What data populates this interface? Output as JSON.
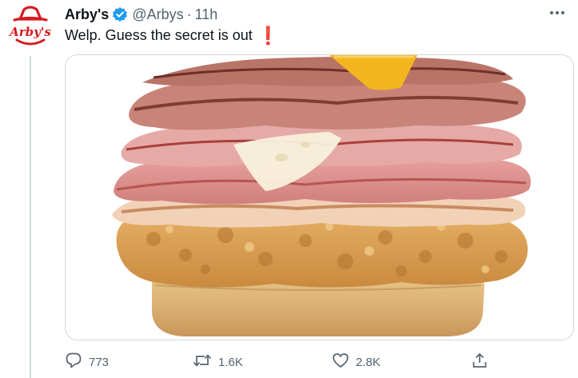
{
  "tweet": {
    "author": {
      "display_name": "Arby's",
      "handle": "@Arbys",
      "verified": true,
      "avatar_brand_text": "Arby's",
      "brand_color": "#d71920"
    },
    "time_separator": "·",
    "time": "11h",
    "text": "Welp. Guess the secret is out",
    "text_emoji": "❗",
    "media": {
      "description_icon": "photo",
      "border_color": "#cfd9de"
    },
    "actions": {
      "reply_count": "773",
      "retweet_count": "1.6K",
      "like_count": "2.8K"
    },
    "colors": {
      "verified_badge": "#1d9bf0",
      "secondary_text": "#536471",
      "emoji_red": "#e0245e"
    }
  }
}
